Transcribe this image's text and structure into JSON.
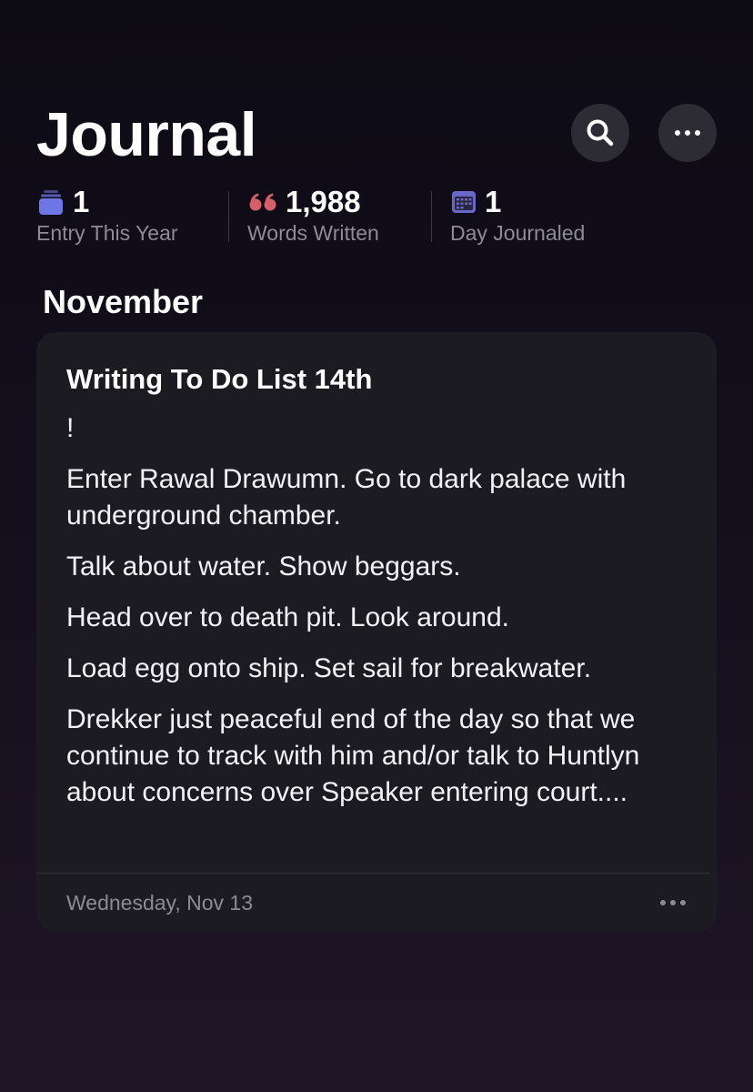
{
  "header": {
    "title": "Journal"
  },
  "stats": [
    {
      "icon": "stack-icon",
      "value": "1",
      "label": "Entry This Year",
      "color": "#6f76e6"
    },
    {
      "icon": "quote-icon",
      "value": "1,988",
      "label": "Words Written",
      "color": "#d65f69"
    },
    {
      "icon": "calendar-icon",
      "value": "1",
      "label": "Day Journaled",
      "color": "#6b66c9"
    }
  ],
  "section": {
    "month": "November"
  },
  "entry": {
    "title": "Writing To Do List 14th",
    "paragraphs": [
      "!",
      "Enter Rawal Drawumn. Go to dark palace with underground chamber.",
      "Talk about water. Show beggars.",
      "Head over to death pit. Look around.",
      "Load egg onto ship. Set sail for breakwater.",
      "Drekker just peaceful end of the day so that we continue to track with him and/or talk to Huntlyn about concerns over Speaker entering court...."
    ],
    "date": "Wednesday, Nov 13"
  }
}
